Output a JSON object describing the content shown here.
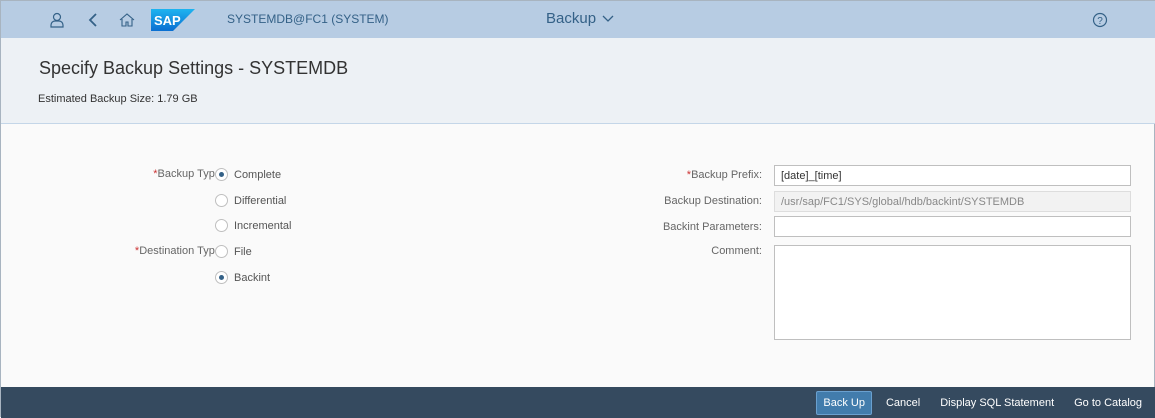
{
  "shell": {
    "system": "SYSTEMDB@FC1 (SYSTEM)",
    "app_title": "Backup",
    "logo": "SAP"
  },
  "header": {
    "title": "Specify Backup Settings - SYSTEMDB",
    "estimated_size": "Estimated Backup Size: 1.79 GB"
  },
  "form": {
    "required_mark": "*",
    "backup_type_label": "Backup Type:",
    "backup_type_options": [
      "Complete",
      "Differential",
      "Incremental"
    ],
    "backup_type_selected": "Complete",
    "destination_type_label": "Destination Type:",
    "destination_type_options": [
      "File",
      "Backint"
    ],
    "destination_type_selected": "Backint",
    "prefix_label": "Backup Prefix:",
    "prefix_value": "[date]_[time]",
    "destination_label": "Backup Destination:",
    "destination_value": "/usr/sap/FC1/SYS/global/hdb/backint/SYSTEMDB",
    "backint_params_label": "Backint Parameters:",
    "backint_params_value": "",
    "comment_label": "Comment:",
    "comment_value": ""
  },
  "footer": {
    "back_up": "Back Up",
    "cancel": "Cancel",
    "display_sql": "Display SQL Statement",
    "catalog": "Go to Catalog"
  }
}
